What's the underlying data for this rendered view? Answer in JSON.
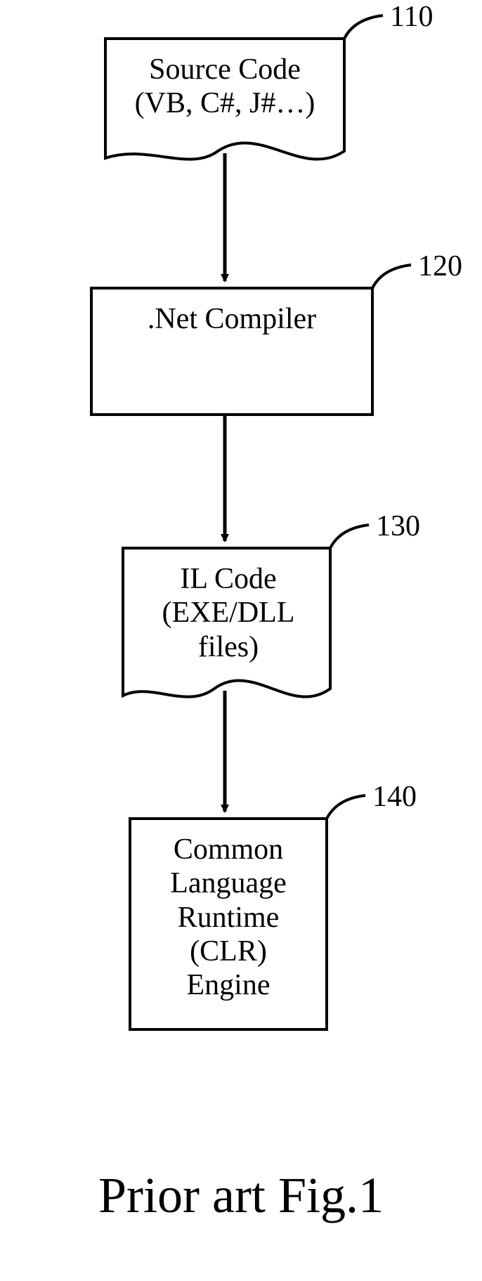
{
  "labels": {
    "n110": "110",
    "n120": "120",
    "n130": "130",
    "n140": "140"
  },
  "boxes": {
    "source_code": "Source Code\n(VB, C#, J#…)",
    "net_compiler": ".Net Compiler",
    "il_code": "IL Code\n(EXE/DLL\nfiles)",
    "clr_engine": "Common\nLanguage\nRuntime\n(CLR)\nEngine"
  },
  "caption": "Prior art Fig.1"
}
